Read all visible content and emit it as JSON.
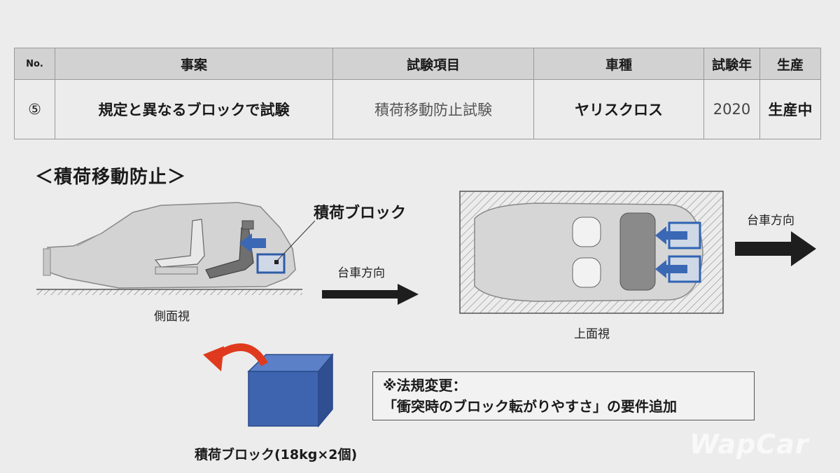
{
  "table": {
    "headers": [
      "No.",
      "事案",
      "試験項目",
      "車種",
      "試験年",
      "生産"
    ],
    "row": {
      "no": "⑤",
      "case": "規定と異なるブロックで試験",
      "test_item": "積荷移動防止試験",
      "model": "ヤリスクロス",
      "year": "2020",
      "production": "生産中"
    }
  },
  "diagram": {
    "title": "＜積荷移動防止＞",
    "cargo_block_label": "積荷ブロック",
    "direction_label_side": "台車方向",
    "direction_label_top": "台車方向",
    "side_view_caption": "側面視",
    "top_view_caption": "上面視",
    "block_caption": "積荷ブロック(18kg×2個)",
    "note_line1": "※法規変更：",
    "note_line2": "「衝突時のブロック転がりやすさ」の要件追加",
    "colors": {
      "block_blue": "#3e64b0",
      "arrow_red": "#e03a1e",
      "arrow_dark": "#1e1e1e"
    }
  },
  "watermark": "WapCar"
}
